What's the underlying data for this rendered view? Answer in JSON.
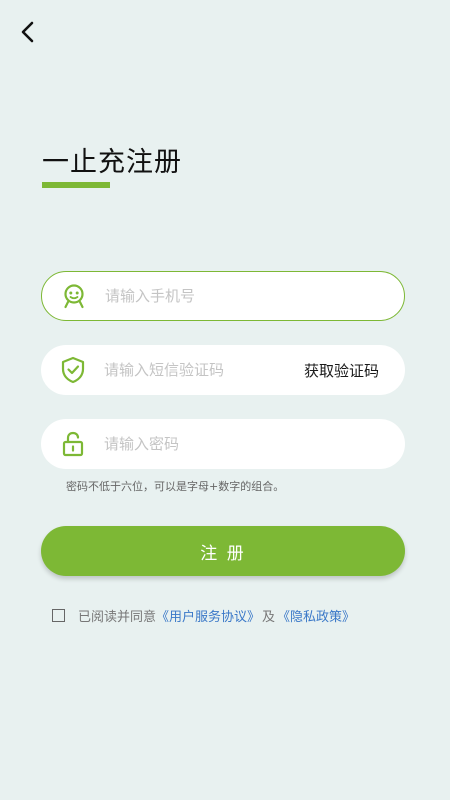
{
  "header": {
    "back_icon": "chevron-left-icon"
  },
  "page": {
    "title": "一止充注册"
  },
  "form": {
    "phone": {
      "placeholder": "请输入手机号",
      "value": "",
      "icon": "user-face-icon"
    },
    "sms_code": {
      "placeholder": "请输入短信验证码",
      "value": "",
      "icon": "shield-check-icon",
      "get_code_label": "获取验证码"
    },
    "password": {
      "placeholder": "请输入密码",
      "value": "",
      "icon": "unlock-icon"
    },
    "password_hint": "密码不低于六位，可以是字母+数字的组合。",
    "submit_label": "注 册"
  },
  "agreement": {
    "checked": false,
    "prefix": "已阅读并同意",
    "service_link": "《用户服务协议》",
    "and_text": "及",
    "privacy_link": "《隐私政策》"
  },
  "colors": {
    "accent": "#7db835",
    "background": "#e8f1f0",
    "link": "#3a78c8"
  }
}
